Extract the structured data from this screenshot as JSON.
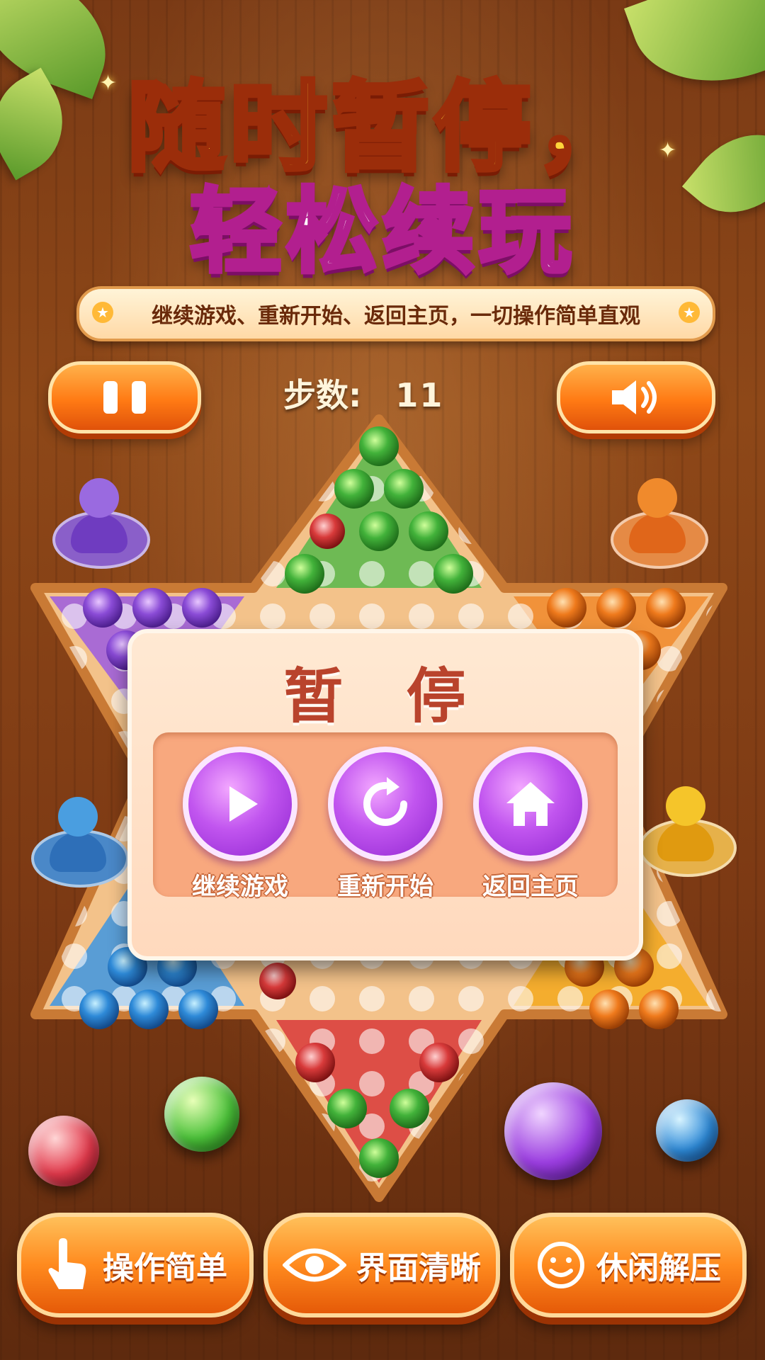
{
  "headline": {
    "line1": "随时暂停，",
    "line2": "轻松续玩"
  },
  "subtitle": "继续游戏、重新开始、返回主页，一切操作简单直观",
  "hud": {
    "steps_label": "步数:",
    "steps_value": "11"
  },
  "pause_modal": {
    "title": "暂 停",
    "options": [
      {
        "label": "继续游戏",
        "icon": "play-icon"
      },
      {
        "label": "重新开始",
        "icon": "restart-icon"
      },
      {
        "label": "返回主页",
        "icon": "home-icon"
      }
    ]
  },
  "features": [
    {
      "label": "操作简单",
      "icon": "hand-pointer-icon"
    },
    {
      "label": "界面清晰",
      "icon": "eye-icon"
    },
    {
      "label": "休闲解压",
      "icon": "smile-icon"
    }
  ],
  "colors": {
    "purple": "#8a4bd6",
    "orange": "#ef7a1c",
    "blue": "#2e8ad8",
    "yellow": "#f3b51d",
    "green": "#42b23a",
    "red": "#d83a3a"
  }
}
